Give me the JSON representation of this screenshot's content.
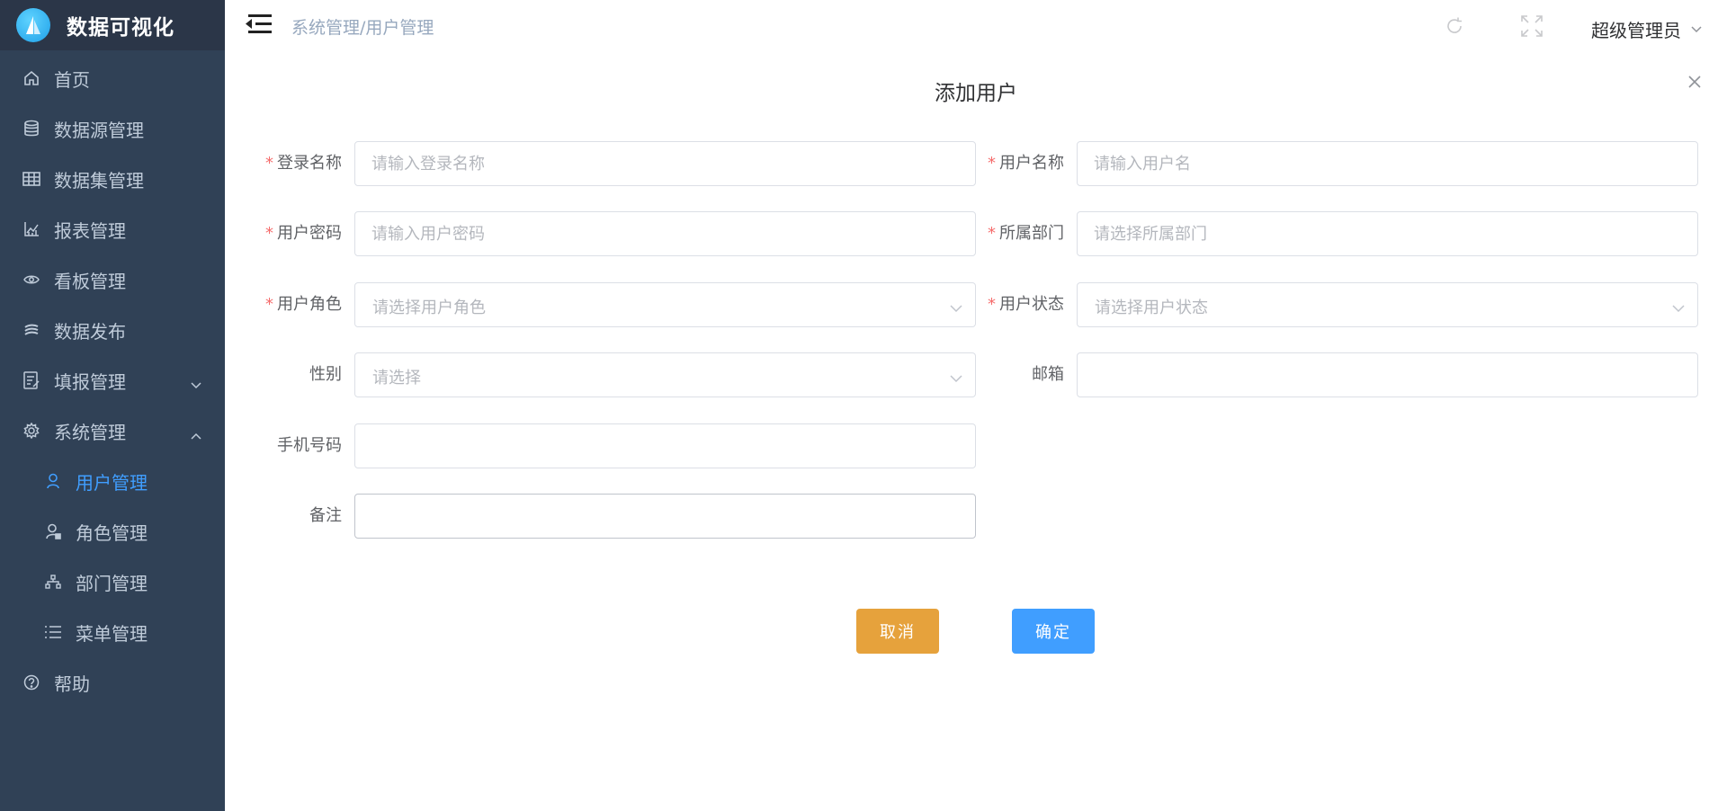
{
  "app": {
    "title": "数据可视化"
  },
  "sidebar": {
    "items": [
      {
        "label": "首页",
        "icon": "home-icon"
      },
      {
        "label": "数据源管理",
        "icon": "database-icon"
      },
      {
        "label": "数据集管理",
        "icon": "table-icon"
      },
      {
        "label": "报表管理",
        "icon": "chart-icon"
      },
      {
        "label": "看板管理",
        "icon": "eye-icon"
      },
      {
        "label": "数据发布",
        "icon": "publish-icon"
      },
      {
        "label": "填报管理",
        "icon": "form-icon",
        "expand": "collapsed"
      },
      {
        "label": "系统管理",
        "icon": "gear-icon",
        "expand": "expanded"
      },
      {
        "label": "用户管理",
        "icon": "user-icon",
        "active": true
      },
      {
        "label": "角色管理",
        "icon": "role-icon"
      },
      {
        "label": "部门管理",
        "icon": "department-icon"
      },
      {
        "label": "菜单管理",
        "icon": "list-icon"
      },
      {
        "label": "帮助",
        "icon": "help-icon"
      }
    ]
  },
  "header": {
    "breadcrumb": "系统管理/用户管理",
    "user": "超级管理员"
  },
  "dialog": {
    "title": "添加用户",
    "fields": {
      "login_name": {
        "label": "登录名称",
        "placeholder": "请输入登录名称",
        "required": true
      },
      "user_name": {
        "label": "用户名称",
        "placeholder": "请输入用户名",
        "required": true
      },
      "password": {
        "label": "用户密码",
        "placeholder": "请输入用户密码",
        "required": true
      },
      "department": {
        "label": "所属部门",
        "placeholder": "请选择所属部门",
        "required": true
      },
      "role": {
        "label": "用户角色",
        "placeholder": "请选择用户角色",
        "required": true
      },
      "status": {
        "label": "用户状态",
        "placeholder": "请选择用户状态",
        "required": true
      },
      "gender": {
        "label": "性别",
        "placeholder": "请选择",
        "required": false
      },
      "email": {
        "label": "邮箱",
        "placeholder": "",
        "required": false
      },
      "phone": {
        "label": "手机号码",
        "placeholder": "",
        "required": false
      },
      "remark": {
        "label": "备注",
        "placeholder": "",
        "required": false
      }
    },
    "required_mark": "*",
    "cancel_label": "取消",
    "ok_label": "确定"
  },
  "colors": {
    "sidebar_bg": "#304156",
    "active": "#409eff",
    "cancel": "#e6a23c",
    "required": "#f56c6c"
  }
}
